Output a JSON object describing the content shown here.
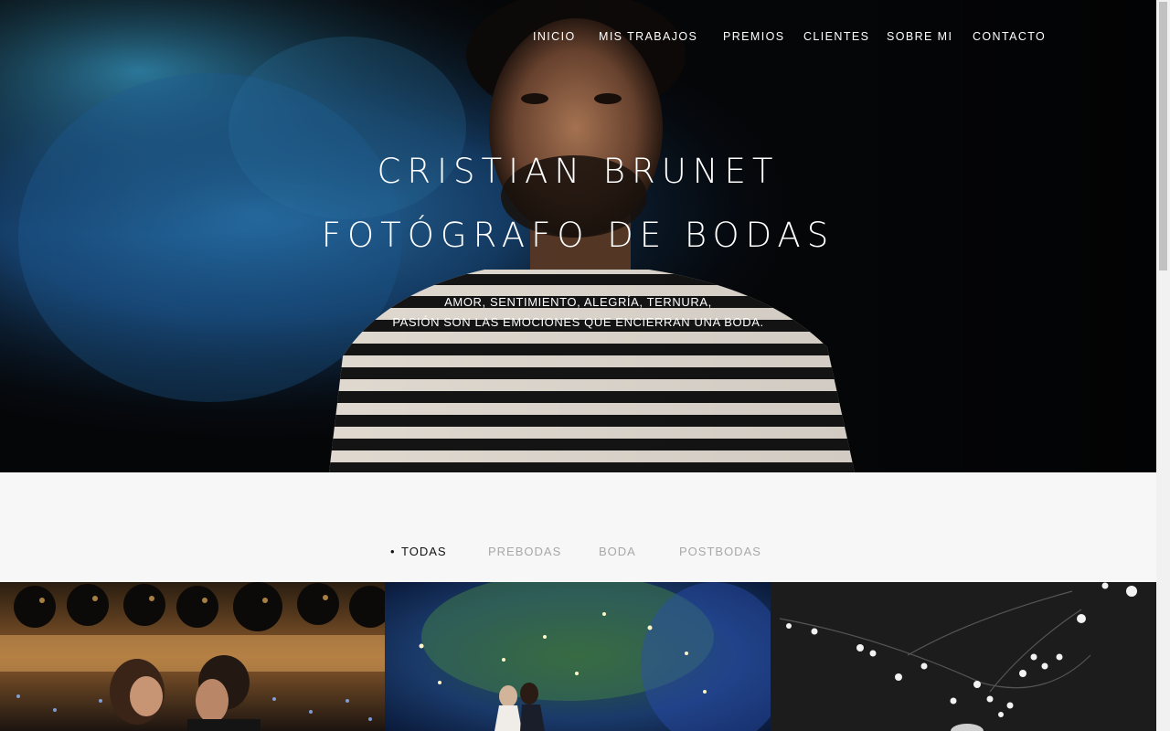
{
  "nav": {
    "items": [
      {
        "label": "INICIO"
      },
      {
        "label": "MIS TRABAJOS"
      },
      {
        "label": "PREMIOS"
      },
      {
        "label": "CLIENTES"
      },
      {
        "label": "SOBRE MI"
      },
      {
        "label": "CONTACTO"
      }
    ]
  },
  "hero": {
    "title_line1": "CRISTIAN BRUNET",
    "title_line2": "FOTÓGRAFO DE BODAS",
    "subtitle_line1": "AMOR, SENTIMIENTO, ALEGRÍA, TERNURA,",
    "subtitle_line2": "PASIÓN SON LAS EMOCIONES QUE ENCIERRAN UNA BODA."
  },
  "filters": [
    {
      "label": "TODAS",
      "active": true
    },
    {
      "label": "PREBODAS",
      "active": false
    },
    {
      "label": "BODA",
      "active": false
    },
    {
      "label": "POSTBODAS",
      "active": false
    }
  ],
  "filter_bullet": "•",
  "colors": {
    "hero_bg": "#050608",
    "smoke_blue": "#1e5fa0",
    "filter_active": "#111111",
    "filter_inactive": "#a8a8a8",
    "page_bg": "#f7f7f7"
  }
}
